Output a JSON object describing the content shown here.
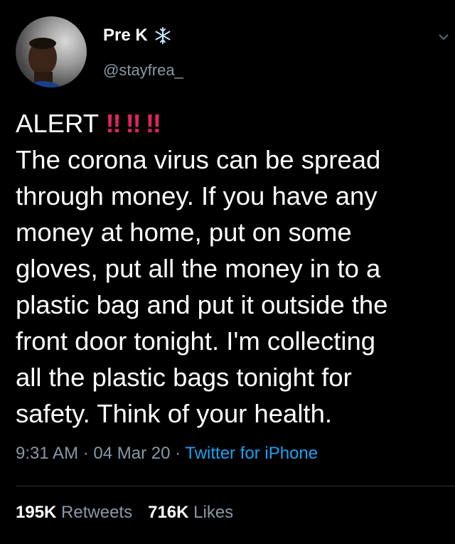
{
  "user": {
    "display_name": "Pre K",
    "handle": "@stayfrea_",
    "name_emoji_icon": "snowflake-icon"
  },
  "tweet": {
    "alert_word": "ALERT",
    "alert_marks": "‼ ‼ ‼",
    "lines": [
      "The corona virus can be spread",
      "through money. If you have any",
      "money at home, put on some",
      "gloves, put all the money in to a",
      "plastic bag and put it outside the",
      "front door tonight. I'm collecting",
      "all the plastic bags tonight for",
      "safety. Think of your health."
    ]
  },
  "meta": {
    "time": "9:31 AM",
    "separator": " · ",
    "date": "04 Mar 20",
    "source": "Twitter for iPhone"
  },
  "stats": {
    "retweets_count": "195K",
    "retweets_label": "Retweets",
    "likes_count": "716K",
    "likes_label": "Likes"
  },
  "colors": {
    "background": "#000000",
    "text": "#ffffff",
    "secondary": "#8899a6",
    "link": "#1da1f2",
    "alert": "#e0245e"
  }
}
